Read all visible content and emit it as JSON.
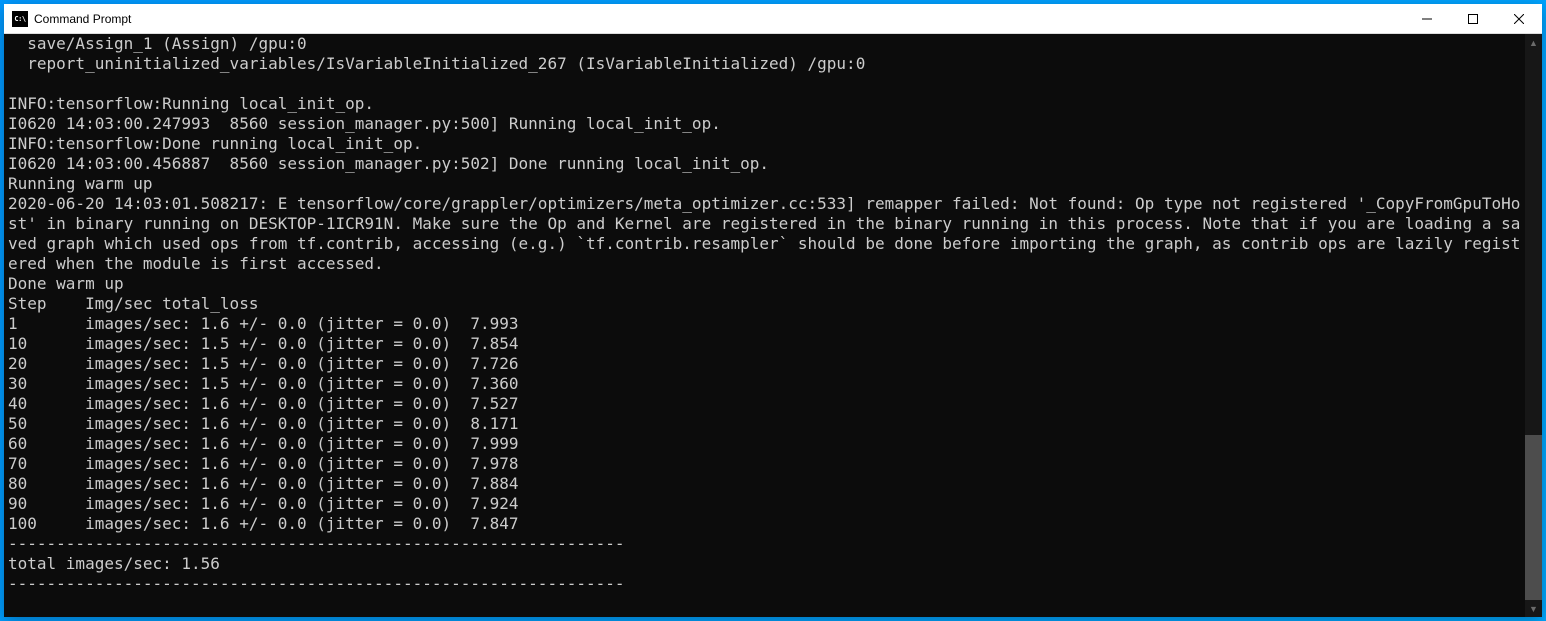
{
  "window": {
    "title": "Command Prompt"
  },
  "terminal": {
    "lines": [
      "  save/Assign_1 (Assign) /gpu:0",
      "  report_uninitialized_variables/IsVariableInitialized_267 (IsVariableInitialized) /gpu:0",
      "",
      "INFO:tensorflow:Running local_init_op.",
      "I0620 14:03:00.247993  8560 session_manager.py:500] Running local_init_op.",
      "INFO:tensorflow:Done running local_init_op.",
      "I0620 14:03:00.456887  8560 session_manager.py:502] Done running local_init_op.",
      "Running warm up",
      "2020-06-20 14:03:01.508217: E tensorflow/core/grappler/optimizers/meta_optimizer.cc:533] remapper failed: Not found: Op type not registered '_CopyFromGpuToHost' in binary running on DESKTOP-1ICR91N. Make sure the Op and Kernel are registered in the binary running in this process. Note that if you are loading a saved graph which used ops from tf.contrib, accessing (e.g.) `tf.contrib.resampler` should be done before importing the graph, as contrib ops are lazily registered when the module is first accessed.",
      "Done warm up",
      "Step    Img/sec total_loss",
      "1       images/sec: 1.6 +/- 0.0 (jitter = 0.0)  7.993",
      "10      images/sec: 1.5 +/- 0.0 (jitter = 0.0)  7.854",
      "20      images/sec: 1.5 +/- 0.0 (jitter = 0.0)  7.726",
      "30      images/sec: 1.5 +/- 0.0 (jitter = 0.0)  7.360",
      "40      images/sec: 1.6 +/- 0.0 (jitter = 0.0)  7.527",
      "50      images/sec: 1.6 +/- 0.0 (jitter = 0.0)  8.171",
      "60      images/sec: 1.6 +/- 0.0 (jitter = 0.0)  7.999",
      "70      images/sec: 1.6 +/- 0.0 (jitter = 0.0)  7.978",
      "80      images/sec: 1.6 +/- 0.0 (jitter = 0.0)  7.884",
      "90      images/sec: 1.6 +/- 0.0 (jitter = 0.0)  7.924",
      "100     images/sec: 1.6 +/- 0.0 (jitter = 0.0)  7.847",
      "----------------------------------------------------------------",
      "total images/sec: 1.56",
      "----------------------------------------------------------------"
    ]
  }
}
